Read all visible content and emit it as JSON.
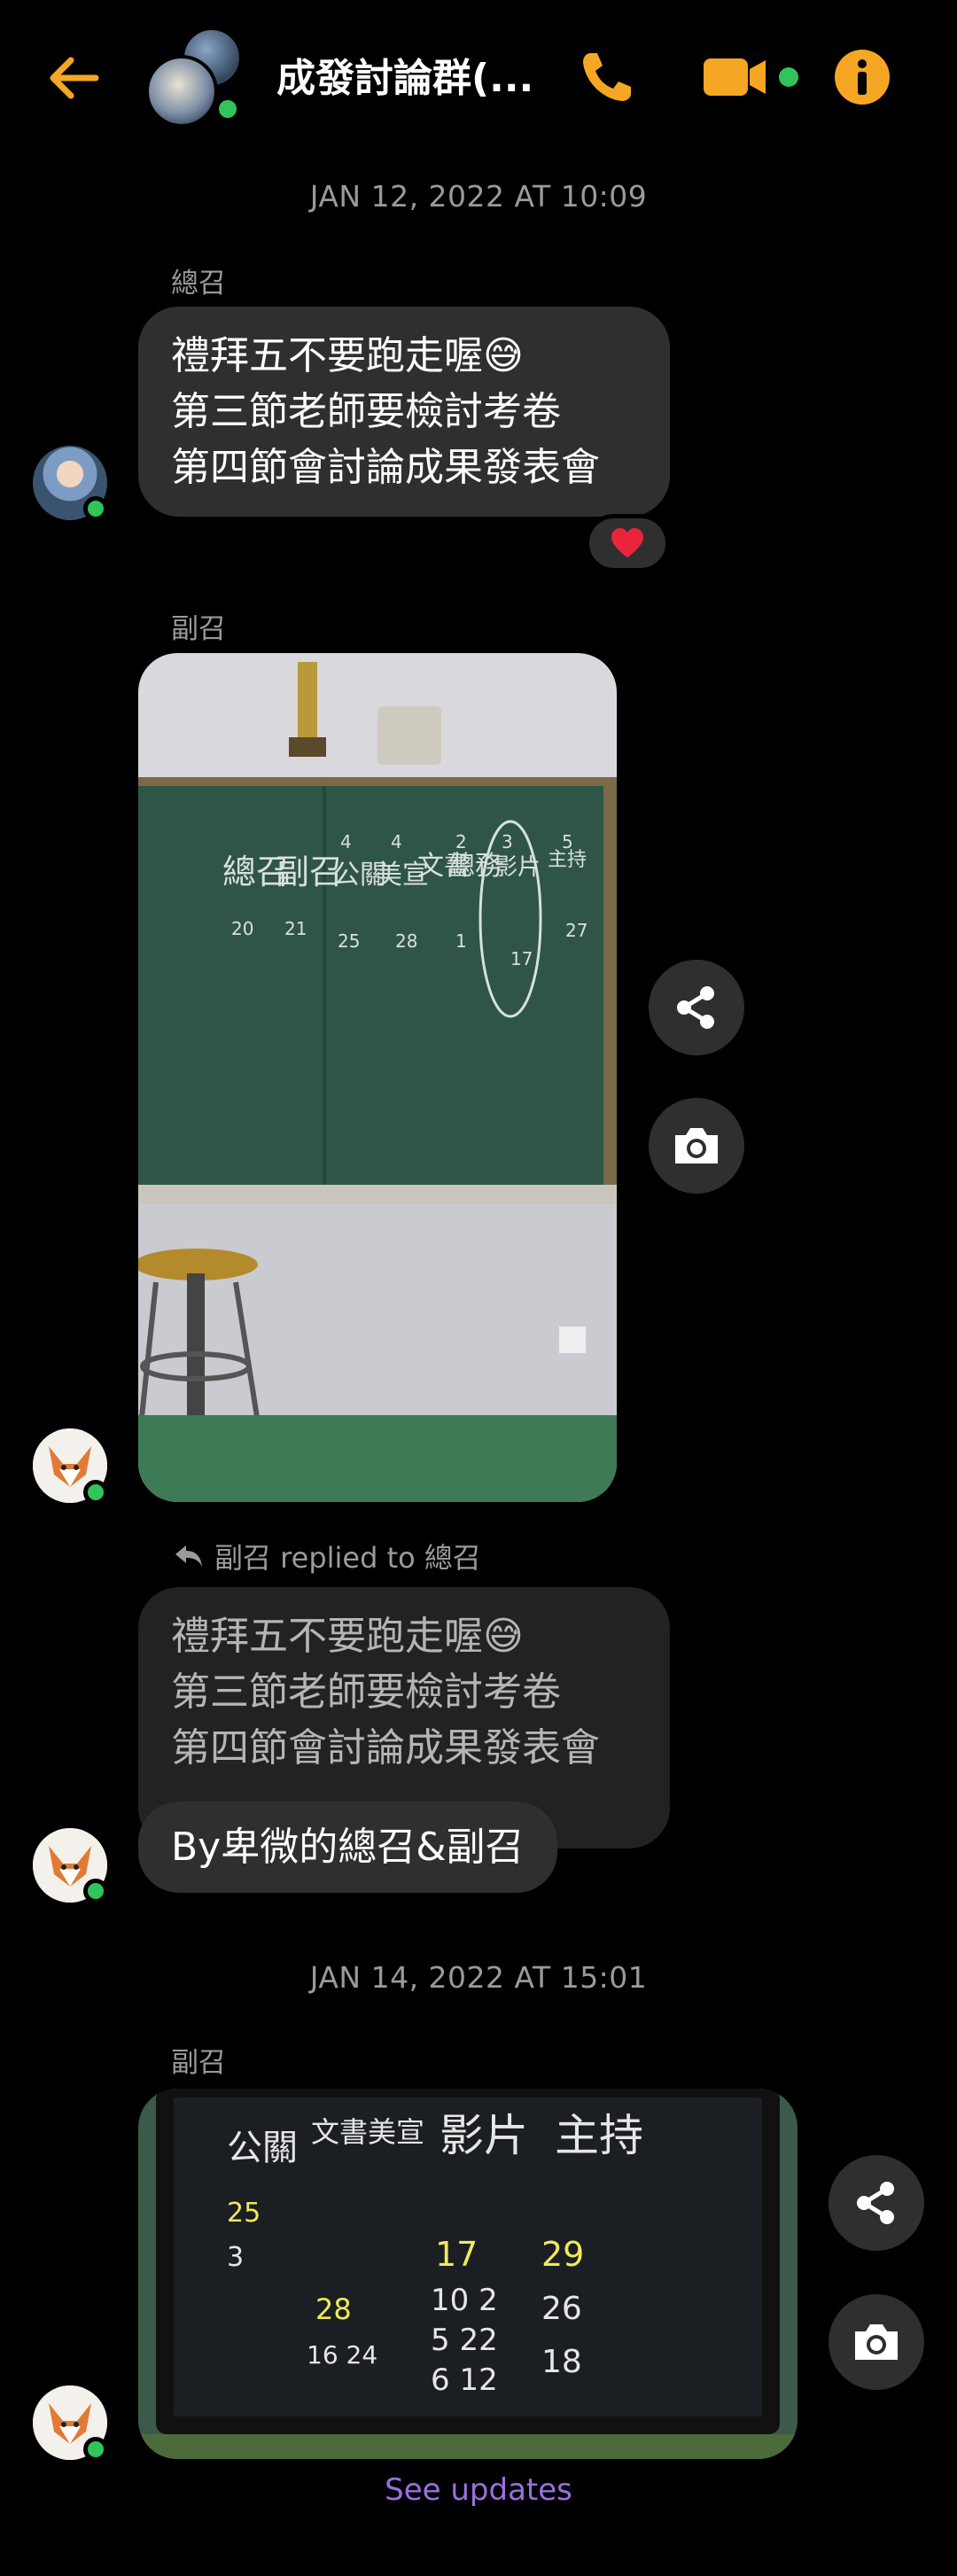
{
  "header": {
    "title": "成發討論群(...",
    "accent_color": "#f5a623",
    "online_color": "#31c45a",
    "icons": [
      "arrow-left-icon",
      "phone-icon",
      "video-camera-icon",
      "info-icon"
    ]
  },
  "messages": {
    "timestamp_1": "JAN 12, 2022 AT 10:09",
    "msg1": {
      "sender": "總召",
      "lines": [
        "禮拜五不要跑走喔😅",
        "第三節老師要檢討考卷",
        "第四節會討論成果發表會"
      ],
      "reaction": "❤️"
    },
    "msg2": {
      "sender": "副召",
      "photo_text": {
        "col_labels": [
          "總召",
          "副召",
          "公關",
          "美宣",
          "文書",
          "總務",
          "影片",
          "主持"
        ],
        "top_numbers": [
          "4",
          "4",
          "2",
          "3",
          "5"
        ],
        "col_numbers": [
          "20",
          "21",
          "25",
          "28",
          "1",
          "17",
          "27"
        ]
      }
    },
    "msg3": {
      "reply_label": "副召 replied to 總召",
      "quoted_lines": [
        "禮拜五不要跑走喔😅",
        "第三節老師要檢討考卷",
        "第四節會討論成果發表會"
      ],
      "text": "By卑微的總召&副召"
    },
    "timestamp_2": "JAN 14, 2022 AT 15:01",
    "msg4": {
      "sender": "副召",
      "photo_text": {
        "col1": [
          "公關",
          "25",
          "3"
        ],
        "col2": [
          "文書美宣",
          "28",
          "16 24"
        ],
        "col3": [
          "影片",
          "17",
          "10 2",
          "5 22",
          "6 12"
        ],
        "col4": [
          "主持",
          "29",
          "26",
          "18"
        ]
      }
    },
    "see_updates": "See updates"
  }
}
